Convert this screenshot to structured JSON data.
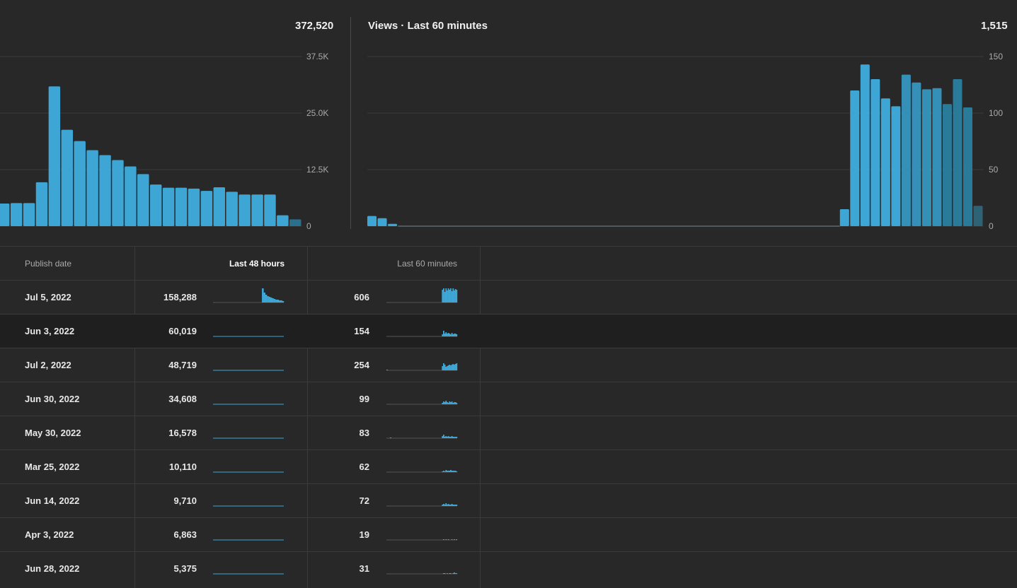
{
  "left_panel": {
    "total": "372,520",
    "chart_data": {
      "type": "bar",
      "title": "",
      "ylim": [
        0,
        37500
      ],
      "y_ticks": [
        "0",
        "12.5K",
        "25.0K",
        "37.5K"
      ],
      "y_tick_values": [
        0,
        12500,
        25000,
        37500
      ],
      "values": [
        5000,
        5100,
        5100,
        9700,
        30900,
        21300,
        18800,
        16800,
        15700,
        14600,
        13200,
        11500,
        9200,
        8500,
        8500,
        8300,
        7800,
        8600,
        7600,
        7000,
        7000,
        7000,
        2400,
        1500
      ],
      "last_bar_dim": true,
      "colors": {
        "bar": "#3ea6d5",
        "bar_dim": "#2a6f8c"
      }
    }
  },
  "right_panel": {
    "title": "Views · Last 60 minutes",
    "total": "1,515",
    "chart_data": {
      "type": "bar",
      "title": "Views · Last 60 minutes",
      "ylim": [
        0,
        150
      ],
      "y_ticks": [
        "0",
        "50",
        "100",
        "150"
      ],
      "y_tick_values": [
        0,
        50,
        100,
        150
      ],
      "values": [
        9,
        7,
        2,
        0,
        0,
        0,
        0,
        0,
        0,
        0,
        0,
        0,
        0,
        0,
        0,
        0,
        0,
        0,
        0,
        0,
        0,
        0,
        0,
        0,
        0,
        0,
        0,
        0,
        0,
        0,
        0,
        0,
        0,
        0,
        0,
        0,
        0,
        0,
        0,
        0,
        0,
        0,
        0,
        0,
        0,
        0,
        15,
        120,
        143,
        130,
        113,
        106,
        134,
        127,
        121,
        122,
        108,
        130,
        105,
        18
      ],
      "colors": {
        "bar": "#3ea6d5",
        "bar_dim": "#2a7a99",
        "bar_dimmer": "#2e6275"
      }
    }
  },
  "table": {
    "headers": {
      "publish_date": "Publish date",
      "last_48": "Last 48 hours",
      "last_60": "Last 60 minutes"
    },
    "rows": [
      {
        "date": "Jul 5, 2022",
        "h48": "158,288",
        "m60": "606",
        "hl": false,
        "s48": [
          0,
          0,
          0,
          0,
          0,
          0,
          0,
          0,
          0,
          0,
          0,
          0,
          0,
          0,
          0,
          0,
          0,
          0,
          0,
          0,
          0,
          0,
          0,
          0,
          0,
          0,
          0,
          0,
          0,
          20,
          14,
          11,
          9,
          8,
          7,
          6,
          5,
          4,
          4,
          3,
          3,
          2
        ],
        "s60": [
          0,
          0,
          0,
          0,
          0,
          0,
          0,
          0,
          0,
          0,
          0,
          0,
          0,
          0,
          0,
          0,
          0,
          0,
          0,
          0,
          0,
          0,
          0,
          0,
          0,
          0,
          0,
          0,
          0,
          0,
          0,
          0,
          0,
          0,
          0,
          0,
          0,
          0,
          0,
          0,
          0,
          0,
          0,
          0,
          0,
          0,
          0,
          18,
          20,
          15,
          20,
          17,
          20,
          18,
          20,
          16,
          20,
          17,
          19,
          18
        ]
      },
      {
        "date": "Jun 3, 2022",
        "h48": "60,019",
        "m60": "154",
        "hl": true,
        "s48": [],
        "s60": [
          0,
          0,
          0,
          0,
          0,
          0,
          0,
          0,
          0,
          0,
          0,
          0,
          0,
          0,
          0,
          0,
          0,
          0,
          0,
          0,
          0,
          0,
          0,
          0,
          0,
          0,
          0,
          0,
          0,
          0,
          0,
          0,
          0,
          0,
          0,
          0,
          0,
          0,
          0,
          0,
          0,
          0,
          0,
          0,
          0,
          0,
          0,
          3,
          8,
          4,
          6,
          4,
          5,
          4,
          3,
          5,
          3,
          4,
          4,
          3
        ]
      },
      {
        "date": "Jul 2, 2022",
        "h48": "48,719",
        "m60": "254",
        "hl": false,
        "s48": [],
        "s60": [
          1,
          0,
          0,
          0,
          0,
          0,
          0,
          0,
          0,
          0,
          0,
          0,
          0,
          0,
          0,
          0,
          0,
          0,
          0,
          0,
          0,
          0,
          0,
          0,
          0,
          0,
          0,
          0,
          0,
          0,
          0,
          0,
          0,
          0,
          0,
          0,
          0,
          0,
          0,
          0,
          0,
          0,
          0,
          0,
          0,
          0,
          0,
          6,
          10,
          8,
          5,
          6,
          7,
          8,
          7,
          8,
          9,
          8,
          9,
          10
        ]
      },
      {
        "date": "Jun 30, 2022",
        "h48": "34,608",
        "m60": "99",
        "hl": false,
        "s48": [],
        "s60": [
          0,
          0,
          0,
          0,
          0,
          0,
          0,
          0,
          0,
          0,
          0,
          0,
          0,
          0,
          0,
          0,
          0,
          0,
          0,
          0,
          0,
          0,
          0,
          0,
          0,
          0,
          0,
          0,
          0,
          0,
          0,
          0,
          0,
          0,
          0,
          0,
          0,
          0,
          0,
          0,
          0,
          0,
          0,
          0,
          0,
          0,
          0,
          2,
          4,
          3,
          5,
          3,
          2,
          4,
          3,
          4,
          2,
          3,
          3,
          2
        ]
      },
      {
        "date": "May 30, 2022",
        "h48": "16,578",
        "m60": "83",
        "hl": false,
        "s48": [],
        "s60": [
          0,
          0,
          0,
          1,
          0,
          0,
          0,
          0,
          0,
          0,
          0,
          0,
          0,
          0,
          0,
          0,
          0,
          0,
          0,
          0,
          0,
          0,
          0,
          0,
          0,
          0,
          0,
          0,
          0,
          0,
          0,
          0,
          0,
          0,
          0,
          0,
          0,
          0,
          0,
          0,
          0,
          0,
          0,
          0,
          0,
          0,
          0,
          3,
          5,
          2,
          3,
          2,
          3,
          2,
          2,
          3,
          2,
          2,
          2,
          2
        ]
      },
      {
        "date": "Mar 25, 2022",
        "h48": "10,110",
        "m60": "62",
        "hl": false,
        "s48": [],
        "s60": [
          0,
          0,
          0,
          0,
          0,
          0,
          0,
          0,
          0,
          0,
          0,
          0,
          0,
          0,
          0,
          0,
          0,
          0,
          0,
          0,
          0,
          0,
          0,
          0,
          0,
          0,
          0,
          0,
          0,
          0,
          0,
          0,
          0,
          0,
          0,
          0,
          0,
          0,
          0,
          0,
          0,
          0,
          0,
          0,
          0,
          0,
          0,
          1,
          2,
          1,
          3,
          2,
          2,
          2,
          3,
          2,
          2,
          2,
          2,
          1
        ]
      },
      {
        "date": "Jun 14, 2022",
        "h48": "9,710",
        "m60": "72",
        "hl": false,
        "s48": [],
        "s60": [
          0,
          0,
          0,
          0,
          0,
          0,
          0,
          0,
          0,
          0,
          0,
          0,
          0,
          0,
          0,
          0,
          0,
          0,
          0,
          0,
          0,
          0,
          0,
          0,
          0,
          0,
          0,
          0,
          0,
          0,
          0,
          0,
          0,
          0,
          0,
          0,
          0,
          0,
          0,
          0,
          0,
          0,
          0,
          0,
          0,
          0,
          0,
          2,
          3,
          2,
          4,
          2,
          3,
          2,
          2,
          3,
          2,
          2,
          2,
          2
        ]
      },
      {
        "date": "Apr 3, 2022",
        "h48": "6,863",
        "m60": "19",
        "hl": false,
        "s48": [],
        "s60": [
          0,
          0,
          0,
          0,
          0,
          0,
          0,
          0,
          0,
          0,
          0,
          0,
          0,
          0,
          0,
          0,
          0,
          0,
          0,
          0,
          0,
          0,
          0,
          0,
          0,
          0,
          0,
          0,
          0,
          0,
          0,
          0,
          0,
          0,
          0,
          0,
          0,
          0,
          0,
          0,
          0,
          0,
          0,
          0,
          0,
          0,
          0,
          0,
          1,
          0,
          1,
          0,
          1,
          0,
          0,
          1,
          0,
          1,
          0,
          1
        ]
      },
      {
        "date": "Jun 28, 2022",
        "h48": "5,375",
        "m60": "31",
        "hl": false,
        "s48": [],
        "s60": [
          0,
          0,
          0,
          0,
          0,
          0,
          0,
          0,
          0,
          0,
          0,
          0,
          0,
          0,
          0,
          0,
          0,
          0,
          0,
          0,
          0,
          0,
          0,
          0,
          0,
          0,
          0,
          0,
          0,
          0,
          0,
          0,
          0,
          0,
          0,
          0,
          0,
          0,
          0,
          0,
          0,
          0,
          0,
          0,
          0,
          0,
          0,
          0,
          1,
          1,
          0,
          1,
          0,
          1,
          1,
          0,
          1,
          2,
          1,
          1
        ]
      }
    ]
  }
}
